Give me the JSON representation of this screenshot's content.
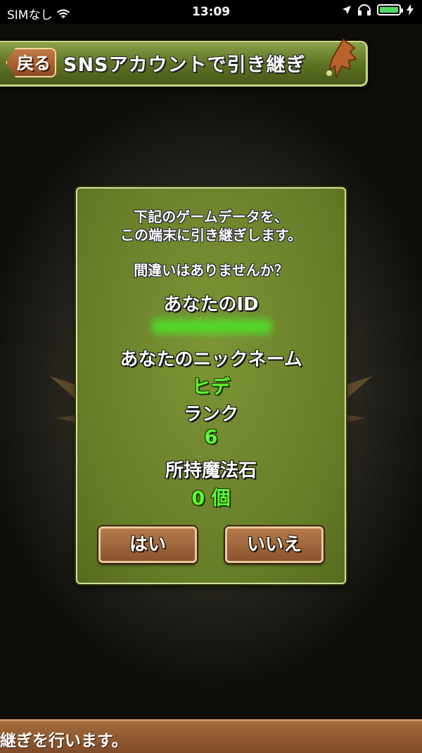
{
  "status_bar": {
    "carrier": "SIMなし",
    "time": "13:09",
    "battery_color": "#4cd964"
  },
  "header": {
    "back_label": "戻る",
    "title": "SNSアカウントで引き継ぎ"
  },
  "dialog": {
    "message_line1": "下記のゲームデータを、",
    "message_line2": "この端末に引き継ぎします。",
    "question": "間違いはありませんか？",
    "id_label": "あなたのID",
    "nickname_label": "あなたのニックネーム",
    "nickname_value": "ヒデ",
    "rank_label": "ランク",
    "rank_value": "6",
    "stones_label": "所持魔法石",
    "stones_value": "0 個",
    "yes_label": "はい",
    "no_label": "いいえ"
  },
  "bottom_message": "継ぎを行います。",
  "colors": {
    "value_green": "#5dff2e",
    "panel_green": "#667d27",
    "button_brown": "#8a5430"
  }
}
